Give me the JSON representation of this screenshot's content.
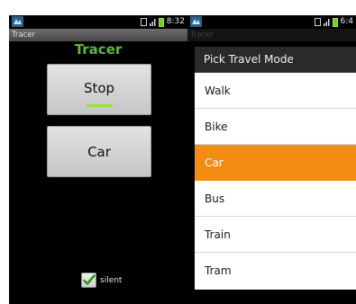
{
  "left": {
    "status": {
      "time": "8:32"
    },
    "title_bar": "Tracer",
    "heading": "Tracer",
    "stop_button": "Stop",
    "mode_button": "Car",
    "silent_label": "silent",
    "silent_checked": true
  },
  "right": {
    "status": {
      "time": "6:4"
    },
    "title_bar": "Tracer",
    "dialog": {
      "title": "Pick Travel Mode",
      "options": [
        {
          "label": "Walk",
          "selected": false
        },
        {
          "label": "Bike",
          "selected": false
        },
        {
          "label": "Car",
          "selected": true
        },
        {
          "label": "Bus",
          "selected": false
        },
        {
          "label": "Train",
          "selected": false
        },
        {
          "label": "Tram",
          "selected": false
        }
      ]
    }
  },
  "colors": {
    "accent_green": "#5bb842",
    "indicator_green": "#9be03b",
    "selection_orange": "#f28c12"
  }
}
